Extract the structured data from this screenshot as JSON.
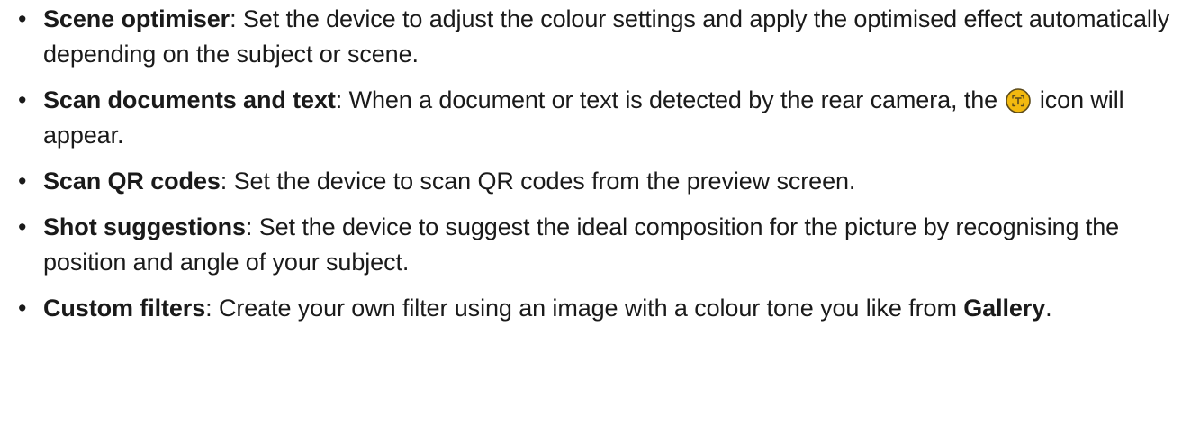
{
  "items": [
    {
      "term": "Scene optimiser",
      "desc": ": Set the device to adjust the colour settings and apply the optimised effect automatically depending on the subject or scene."
    },
    {
      "term": "Scan documents and text",
      "desc_before_icon": ": When a document or text is detected by the rear camera, the ",
      "icon": "scan-text-icon",
      "desc_after_icon": " icon will appear."
    },
    {
      "term": "Scan QR codes",
      "desc": ": Set the device to scan QR codes from the preview screen."
    },
    {
      "term": "Shot suggestions",
      "desc": ": Set the device to suggest the ideal composition for the picture by recognising the position and angle of your subject."
    },
    {
      "term": "Custom filters",
      "desc_before_app": ": Create your own filter using an image with a colour tone you like from ",
      "app_name": "Gallery",
      "desc_after_app": "."
    }
  ],
  "bullet_char": "•",
  "colors": {
    "text": "#1a1a1a",
    "icon_fill": "#f2b90f",
    "icon_ring": "#5b4a1c"
  }
}
